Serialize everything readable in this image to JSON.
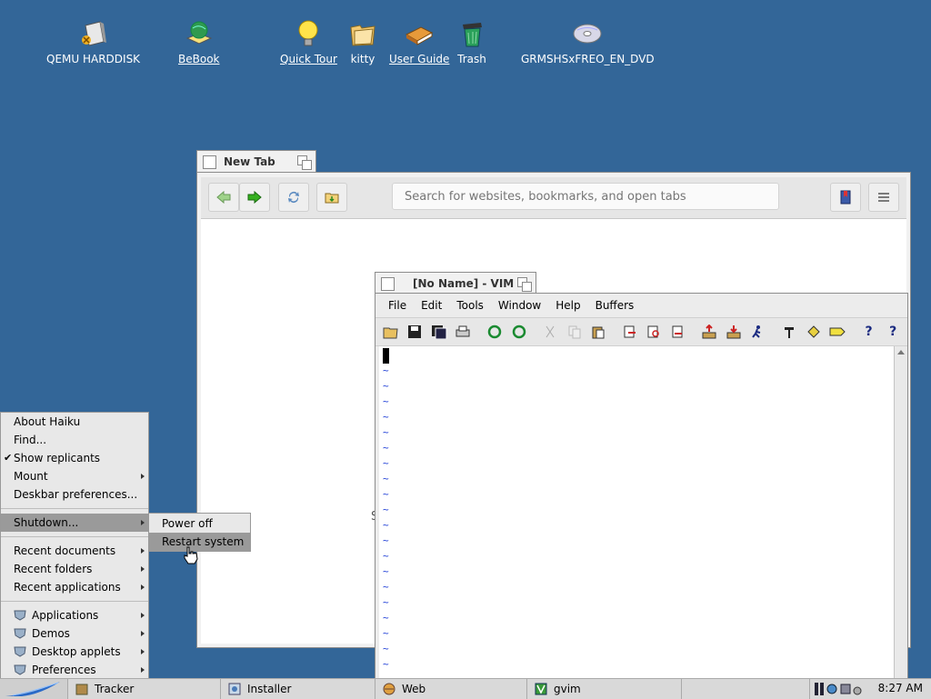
{
  "desktop": {
    "icons": [
      {
        "name": "qemu-harddisk-icon",
        "label": "QEMU HARDDISK",
        "underline": false
      },
      {
        "name": "bebook-icon",
        "label": "BeBook",
        "underline": true
      },
      {
        "name": "quick-tour-icon",
        "label": "Quick Tour",
        "underline": true
      },
      {
        "name": "kitty-icon",
        "label": "kitty",
        "underline": false
      },
      {
        "name": "user-guide-icon",
        "label": "User Guide",
        "underline": true
      },
      {
        "name": "trash-icon",
        "label": "Trash",
        "underline": false
      },
      {
        "name": "dvd-icon",
        "label": "GRMSHSxFREO_EN_DVD",
        "underline": false
      }
    ]
  },
  "web_window": {
    "tab_title": "New Tab",
    "search_placeholder": "Search for websites, bookmarks, and open tabs",
    "stray_text": "S"
  },
  "vim_window": {
    "tab_title": "[No Name] - VIM",
    "menu": [
      "File",
      "Edit",
      "Tools",
      "Window",
      "Help",
      "Buffers"
    ],
    "tilde": "~",
    "tilde_count": 20,
    "help_glyph": "?"
  },
  "deskbar_menu": {
    "items": [
      {
        "label": "About Haiku"
      },
      {
        "label": "Find..."
      },
      {
        "label": "Show replicants",
        "checked": true
      },
      {
        "label": "Mount",
        "submenu": true
      },
      {
        "label": "Deskbar preferences..."
      },
      {
        "label": "Shutdown...",
        "submenu": true,
        "highlighted": true
      },
      {
        "label": "Recent documents",
        "submenu": true
      },
      {
        "label": "Recent folders",
        "submenu": true
      },
      {
        "label": "Recent applications",
        "submenu": true
      },
      {
        "label": "Applications",
        "submenu": true
      },
      {
        "label": "Demos",
        "submenu": true
      },
      {
        "label": "Desktop applets",
        "submenu": true
      },
      {
        "label": "Preferences",
        "submenu": true
      }
    ],
    "check_glyph": "✔"
  },
  "shutdown_submenu": {
    "power_off": "Power off",
    "restart": "Restart system"
  },
  "taskbar": {
    "items": [
      "Tracker",
      "Installer",
      "Web",
      "gvim"
    ],
    "clock": "8:27 AM"
  },
  "colors": {
    "desktop": "#336698",
    "menu_highlight": "#9a9a9a",
    "vim_tilde": "#1c3cd6"
  }
}
